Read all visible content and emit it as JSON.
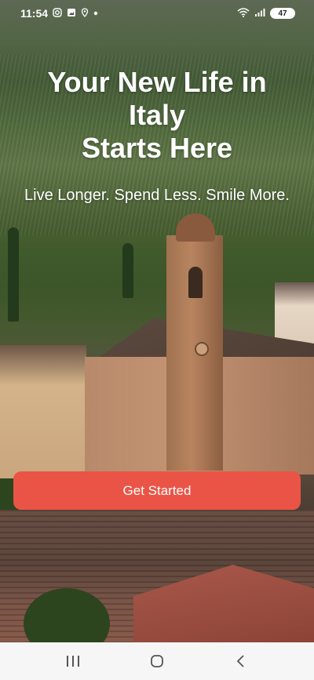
{
  "status_bar": {
    "time": "11:54",
    "battery": "47",
    "icons": [
      "instagram-icon",
      "image-icon",
      "location-icon",
      "dot-icon",
      "wifi-icon",
      "signal-icon",
      "battery-icon"
    ]
  },
  "hero": {
    "title_line1": "Your New Life in Italy",
    "title_line2": "Starts Here",
    "subtitle": "Live Longer. Spend Less. Smile More."
  },
  "cta": {
    "label": "Get Started",
    "color": "#ea5446"
  },
  "nav_bar": {
    "icons": [
      "recent-apps-icon",
      "home-icon",
      "back-icon"
    ]
  }
}
